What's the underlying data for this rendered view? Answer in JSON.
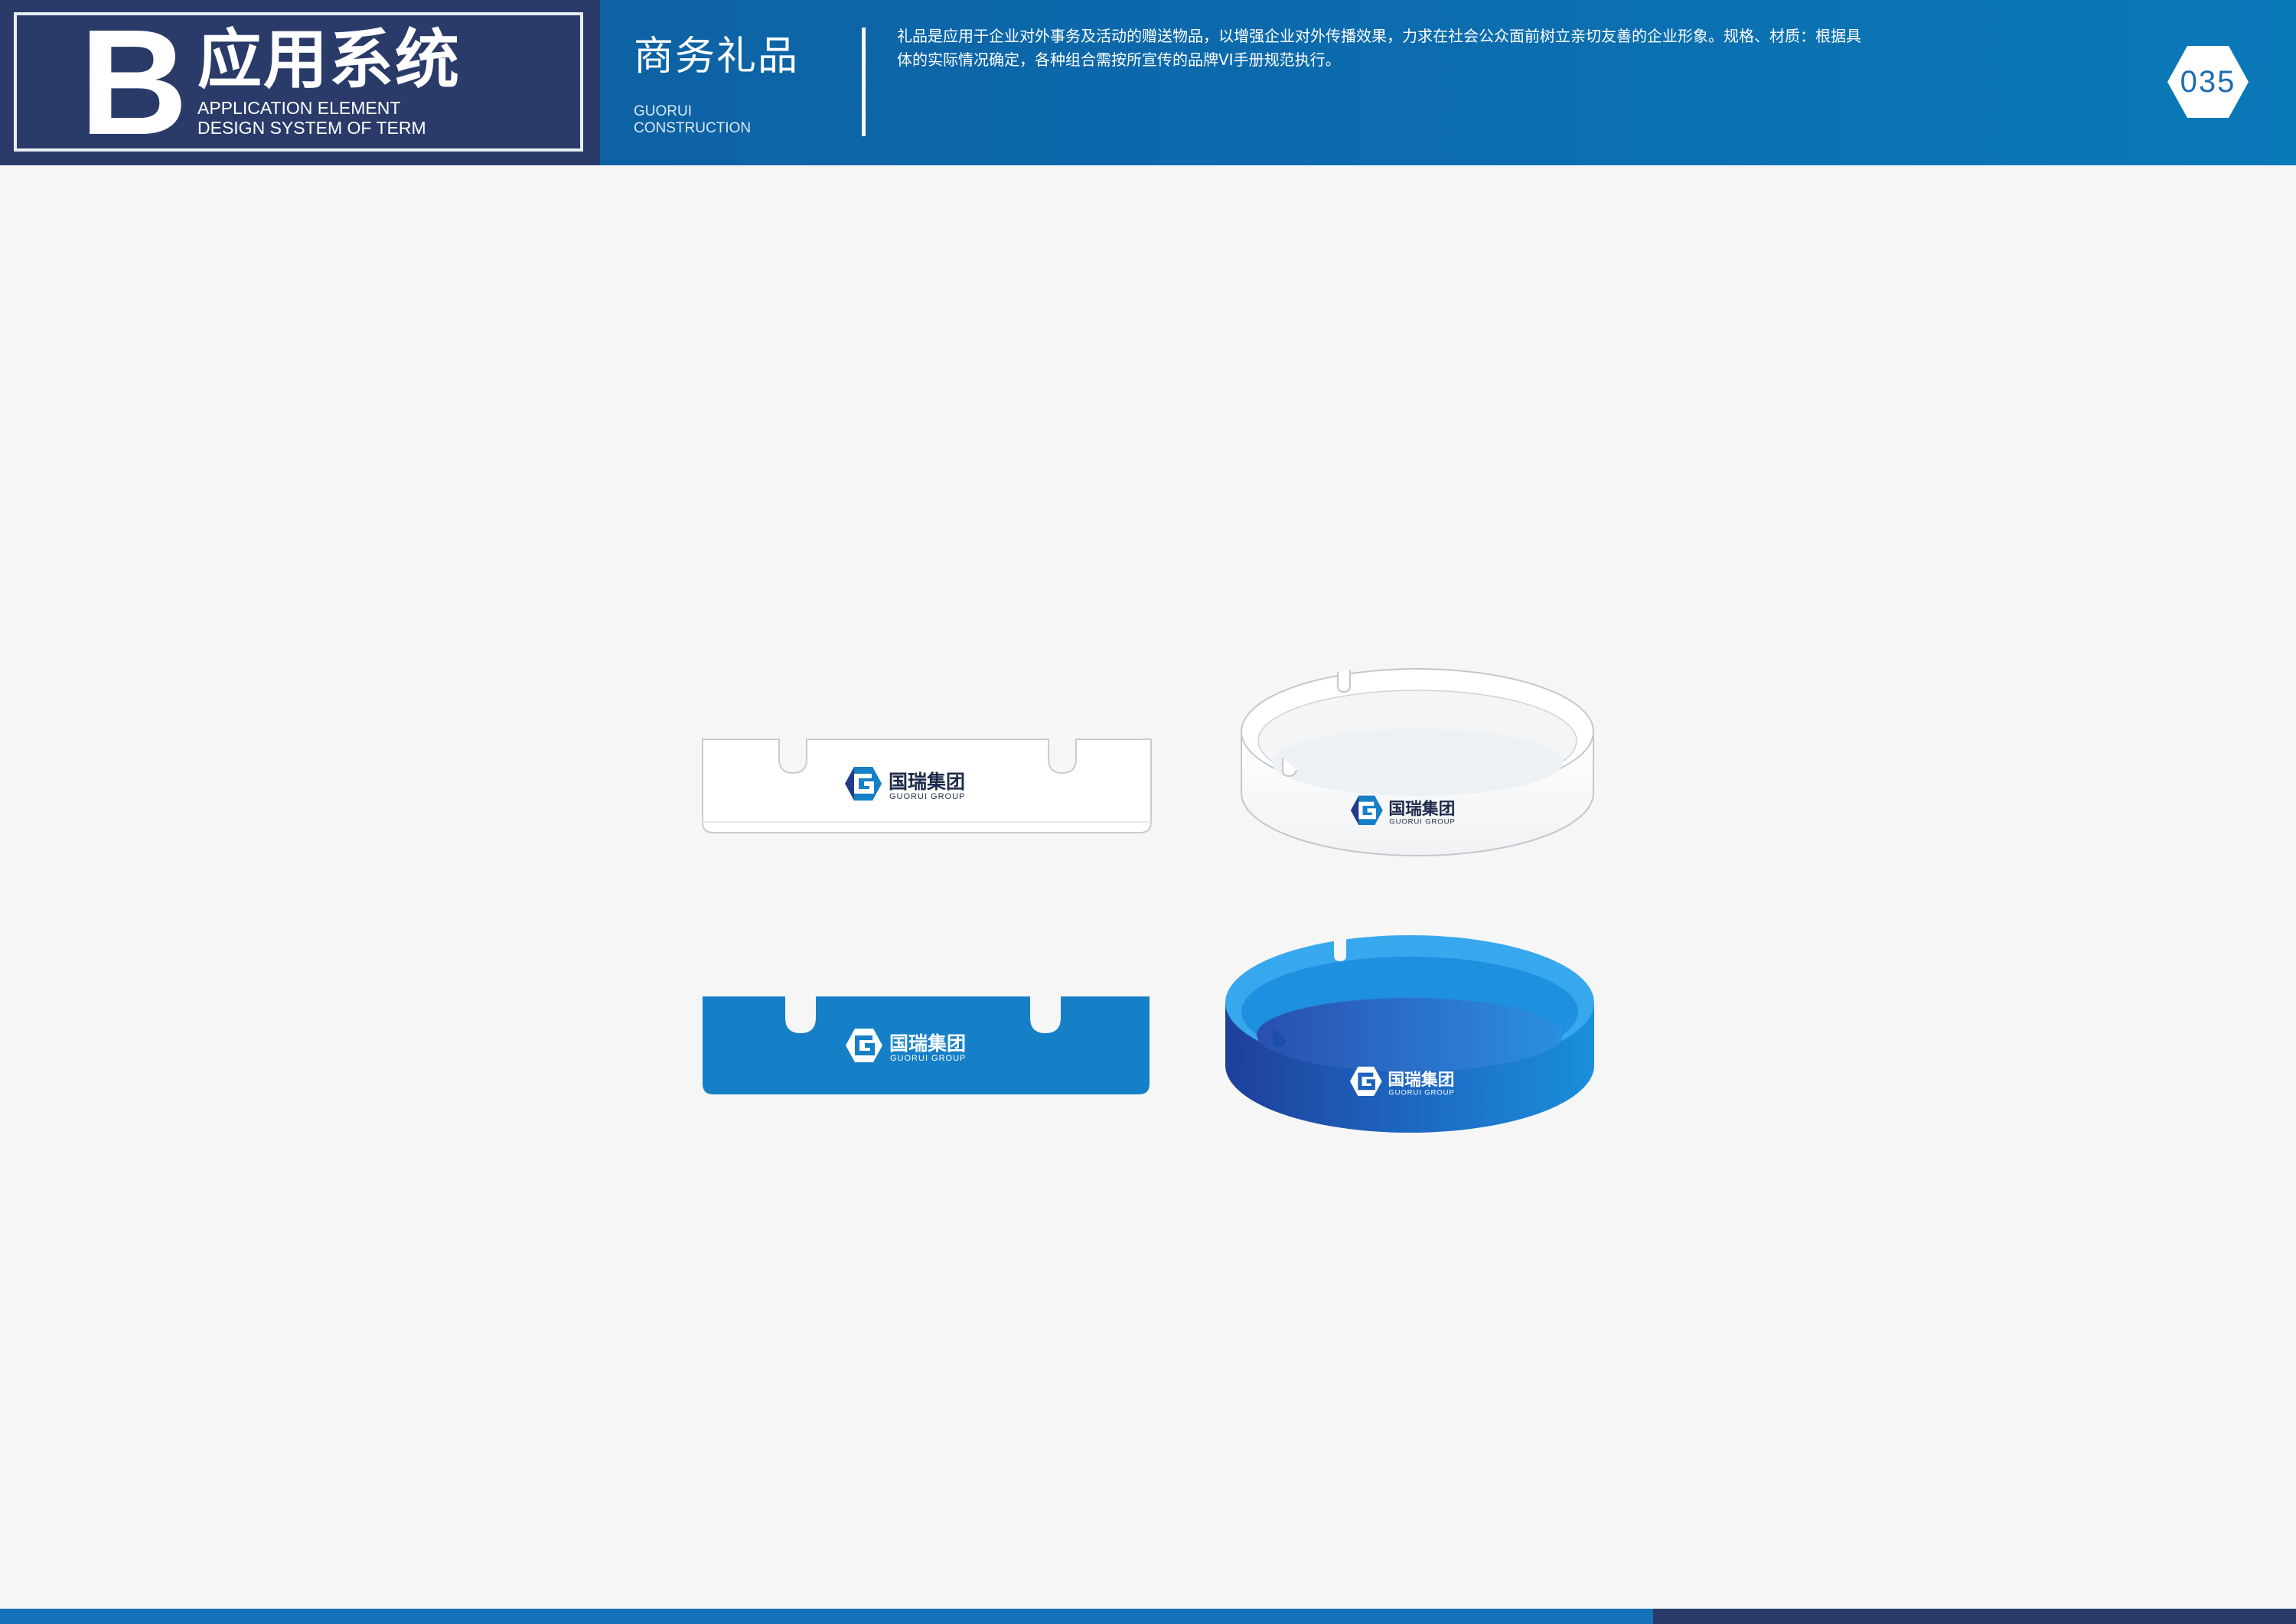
{
  "header": {
    "section_letter": "B",
    "section_title": "应用系统",
    "section_subtitle_line1": "APPLICATION ELEMENT",
    "section_subtitle_line2": "DESIGN SYSTEM OF TERM",
    "category_title": "商务礼品",
    "category_subtitle_line1": "GUORUI",
    "category_subtitle_line2": "CONSTRUCTION",
    "description": "礼品是应用于企业对外事务及活动的赠送物品，以增强企业对外传播效果，力求在社会公众面前树立亲切友善的企业形象。规格、材质：根据具体的实际情况确定，各种组合需按所宣传的品牌VI手册规范执行。",
    "page_number": "035"
  },
  "brand": {
    "name_cn": "国瑞集团",
    "name_en": "GUORUI GROUP",
    "logo_icon": "hexagon-g-logo-icon"
  },
  "products": [
    {
      "name": "white-ashtray-side-view",
      "variant": "white"
    },
    {
      "name": "white-ashtray-perspective-view",
      "variant": "white"
    },
    {
      "name": "blue-ashtray-side-view",
      "variant": "blue"
    },
    {
      "name": "blue-ashtray-perspective-view",
      "variant": "blue"
    }
  ],
  "colors": {
    "header_blue": "#0c6aac",
    "section_navy": "#2a3b6a",
    "brand_blue": "#1580c8",
    "brand_navy": "#233b8c",
    "background": "#f6f6f7"
  }
}
